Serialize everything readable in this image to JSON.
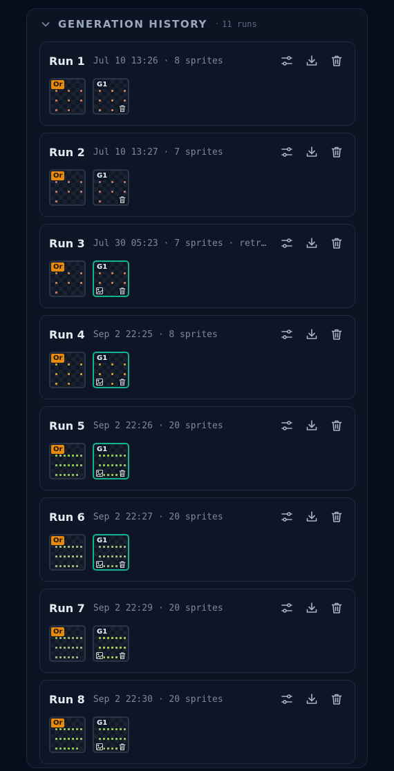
{
  "panel": {
    "title": "GENERATION HISTORY",
    "count": "11 runs",
    "collapse_icon": "chevron-down-icon"
  },
  "actions": [
    "sliders-icon",
    "download-icon",
    "trash-icon"
  ],
  "colors": {
    "accent_active": "#13b38d",
    "original_badge": "#e88b0a"
  },
  "runs": [
    {
      "label": "Run 1",
      "meta": "Jul 10 13:26 · 8 sprites",
      "original": {
        "badge": "Or",
        "sprite_color": "#d67a5f",
        "sprites": 8
      },
      "generated": {
        "badge": "G1",
        "active": false,
        "has_image_icon": false,
        "sprite_color": "#d9895f",
        "sprites": 8
      }
    },
    {
      "label": "Run 2",
      "meta": "Jul 10 13:27 · 7 sprites",
      "original": {
        "badge": "Or",
        "sprite_color": "#c97a69",
        "sprites": 7
      },
      "generated": {
        "badge": "G1",
        "active": false,
        "has_image_icon": false,
        "sprite_color": "#c97a69",
        "sprites": 7
      }
    },
    {
      "label": "Run 3",
      "meta": "Jul 30 05:23 · 7 sprites · retry …",
      "original": {
        "badge": "Or",
        "sprite_color": "#cf8060",
        "sprites": 7
      },
      "generated": {
        "badge": "G1",
        "active": true,
        "has_image_icon": true,
        "sprite_color": "#cf8060",
        "sprites": 7
      }
    },
    {
      "label": "Run 4",
      "meta": "Sep 2 22:25 · 8 sprites",
      "original": {
        "badge": "Or",
        "sprite_color": "#d8a02b",
        "sprites": 8
      },
      "generated": {
        "badge": "G1",
        "active": true,
        "has_image_icon": true,
        "sprite_color": "#d8a02b",
        "sprites": 8
      }
    },
    {
      "label": "Run 5",
      "meta": "Sep 2 22:26 · 20 sprites",
      "original": {
        "badge": "Or",
        "sprite_color": "#9ccf56",
        "sprites": 20
      },
      "generated": {
        "badge": "G1",
        "active": true,
        "has_image_icon": true,
        "sprite_color": "#9ccf56",
        "sprites": 20
      }
    },
    {
      "label": "Run 6",
      "meta": "Sep 2 22:27 · 20 sprites",
      "original": {
        "badge": "Or",
        "sprite_color": "#a3c27e",
        "sprites": 20
      },
      "generated": {
        "badge": "G1",
        "active": true,
        "has_image_icon": true,
        "sprite_color": "#a3c27e",
        "sprites": 20
      }
    },
    {
      "label": "Run 7",
      "meta": "Sep 2 22:29 · 20 sprites",
      "original": {
        "badge": "Or",
        "sprite_color": "#a8b97f",
        "sprites": 20
      },
      "generated": {
        "badge": "G1",
        "active": false,
        "has_image_icon": true,
        "sprite_color": "#b9cf4f",
        "sprites": 20
      }
    },
    {
      "label": "Run 8",
      "meta": "Sep 2 22:30 · 20 sprites",
      "original": {
        "badge": "Or",
        "sprite_color": "#9ccf56",
        "sprites": 20
      },
      "generated": {
        "badge": "G1",
        "active": false,
        "has_image_icon": true,
        "sprite_color": "#9ccf56",
        "sprites": 20
      }
    }
  ]
}
